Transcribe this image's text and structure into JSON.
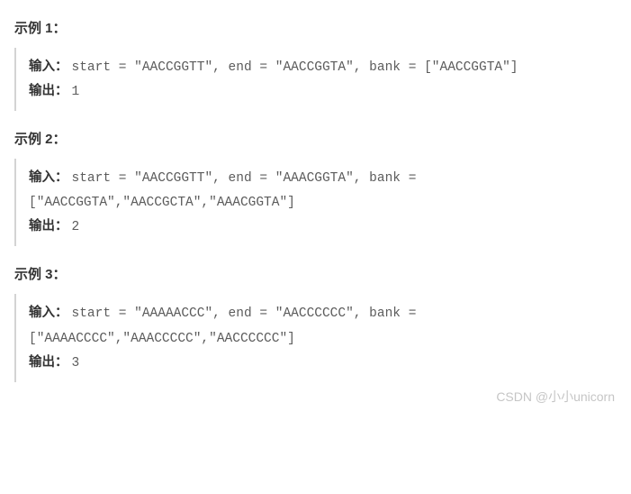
{
  "examples": [
    {
      "title": "示例 1：",
      "input_label": "输入：",
      "input_code": "start = \"AACCGGTT\", end = \"AACCGGTA\", bank = [\"AACCGGTA\"]",
      "output_label": "输出：",
      "output_code": "1"
    },
    {
      "title": "示例 2：",
      "input_label": "输入：",
      "input_code": "start = \"AACCGGTT\", end = \"AAACGGTA\", bank = [\"AACCGGTA\",\"AACCGCTA\",\"AAACGGTA\"]",
      "output_label": "输出：",
      "output_code": "2"
    },
    {
      "title": "示例 3：",
      "input_label": "输入：",
      "input_code": "start = \"AAAAACCC\", end = \"AACCCCCC\", bank = [\"AAAACCCC\",\"AAACCCCC\",\"AACCCCCC\"]",
      "output_label": "输出：",
      "output_code": "3"
    }
  ],
  "watermark": "CSDN @小小unicorn"
}
